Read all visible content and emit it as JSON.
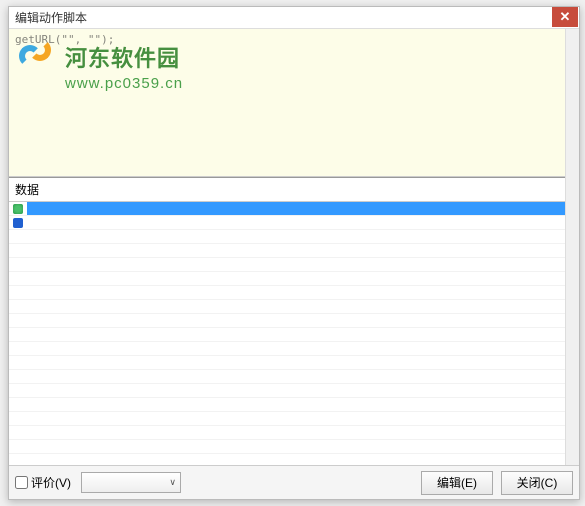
{
  "window": {
    "title": "编辑动作脚本"
  },
  "code": {
    "line1": "getURL(\"\", \"\");"
  },
  "watermark": {
    "main_text": "河东软件园",
    "sub_text": "www.pc0359.cn"
  },
  "data_panel": {
    "header": "数据",
    "rows": [
      {
        "marker": "green",
        "selected": true,
        "label": ""
      },
      {
        "marker": "blue",
        "selected": false,
        "label": ""
      }
    ]
  },
  "bottom": {
    "evaluate_label": "评价(V)",
    "dropdown_value": "",
    "edit_button": "编辑(E)",
    "close_button": "关闭(C)"
  }
}
